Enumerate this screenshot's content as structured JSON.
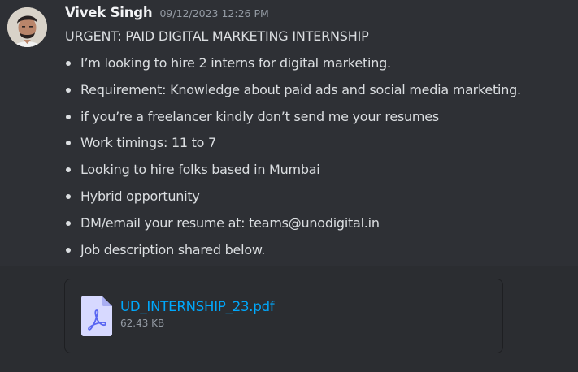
{
  "message": {
    "author": "Vivek Singh",
    "timestamp": "09/12/2023 12:26 PM",
    "title": "URGENT: PAID DIGITAL MARKETING INTERNSHIP",
    "bullets": [
      "I’m looking to hire 2 interns for digital marketing.",
      "Requirement: Knowledge about  paid ads and social media marketing.",
      "if you’re a freelancer kindly don’t send me your resumes",
      "Work timings: 11 to 7",
      "Looking to hire folks based in Mumbai",
      "Hybrid opportunity",
      "DM/email your resume at: teams@unodigital.in",
      "Job description shared below."
    ]
  },
  "attachment": {
    "file_name": "UD_INTERNSHIP_23.pdf",
    "file_size": "62.43 KB",
    "icon": "pdf-file-icon"
  },
  "colors": {
    "background": "#2b2d31",
    "message_highlight": "#2e3035",
    "text": "#dbdee1",
    "muted": "#949ba4",
    "link": "#00a8fc"
  }
}
